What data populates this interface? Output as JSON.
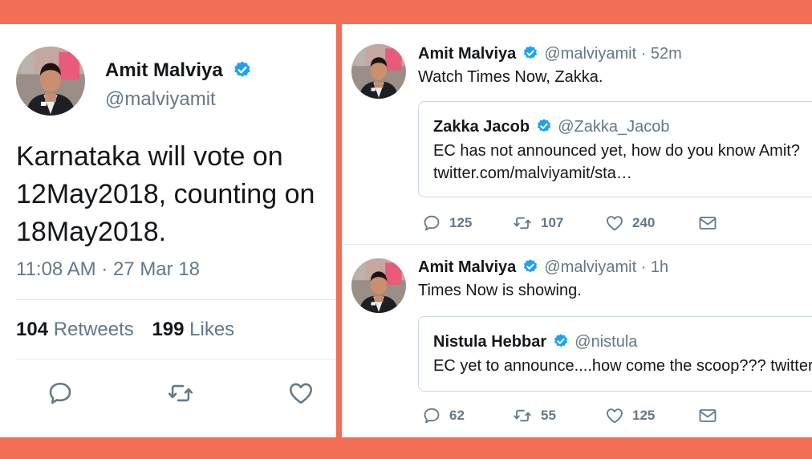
{
  "left_tweet": {
    "name": "Amit Malviya",
    "handle": "@malviyamit",
    "text": "Karnataka will vote on\n12May2018, counting on\n18May2018.",
    "time": "11:08 AM · 27 Mar 18",
    "retweets_count": "104",
    "retweets_label": "Retweets",
    "likes_count": "199",
    "likes_label": "Likes"
  },
  "right_tweets": [
    {
      "name": "Amit Malviya",
      "handle": "@malviyamit",
      "time": "· 52m",
      "text": "Watch Times Now, Zakka.",
      "quote": {
        "name": "Zakka Jacob",
        "handle": "@Zakka_Jacob",
        "line1": "EC has not announced yet, how do you know Amit?",
        "line2": "twitter.com/malviyamit/sta…"
      },
      "replies": "125",
      "retweets": "107",
      "likes": "240"
    },
    {
      "name": "Amit Malviya",
      "handle": "@malviyamit",
      "time": "· 1h",
      "text": "Times Now is showing.",
      "quote": {
        "name": "Nistula Hebbar",
        "handle": "@nistula",
        "line1": "EC yet to announce....how come the scoop??? twitter"
      },
      "replies": "62",
      "retweets": "55",
      "likes": "125"
    }
  ],
  "colors": {
    "background": "#f26f55",
    "verified": "#1da1f2",
    "muted_text": "#657786"
  },
  "icons": [
    "reply-icon",
    "retweet-icon",
    "like-icon",
    "dm-icon",
    "verified-badge-icon"
  ]
}
